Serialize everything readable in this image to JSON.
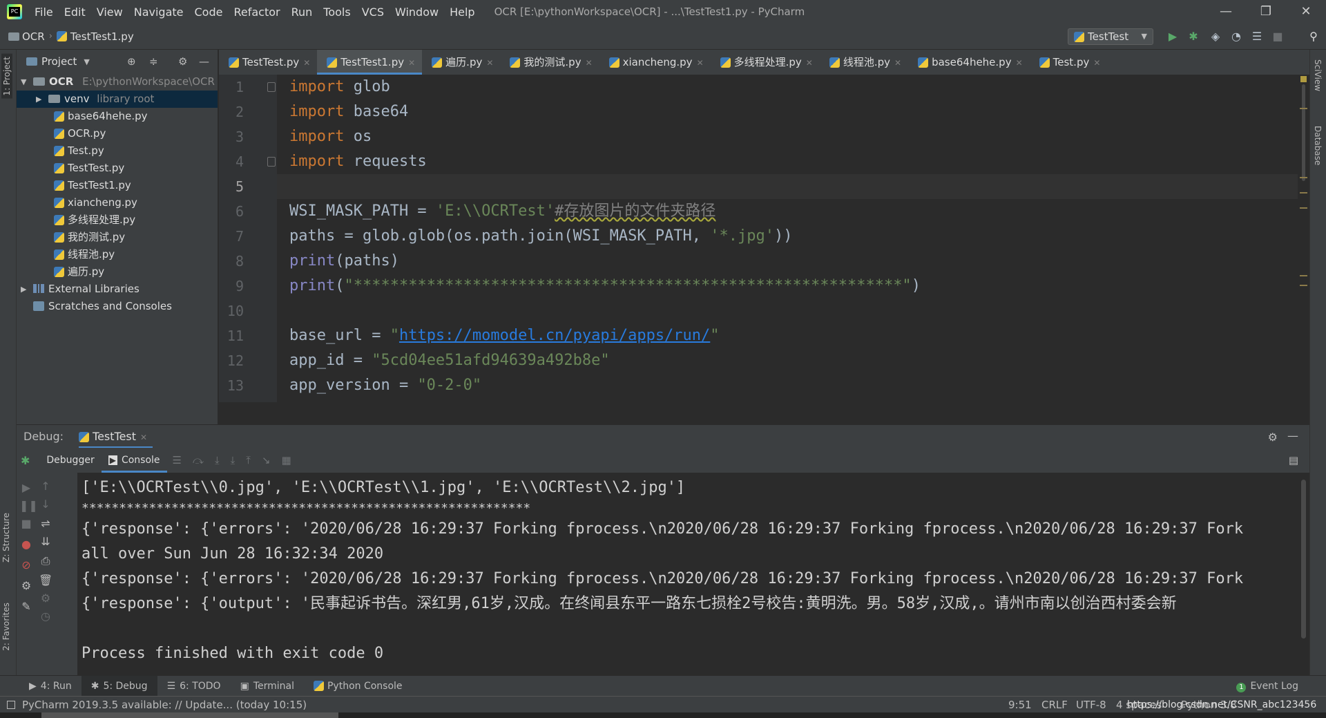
{
  "menu": {
    "items": [
      "File",
      "Edit",
      "View",
      "Navigate",
      "Code",
      "Refactor",
      "Run",
      "Tools",
      "VCS",
      "Window",
      "Help"
    ],
    "window_title": "OCR [E:\\pythonWorkspace\\OCR] - ...\\TestTest1.py - PyCharm"
  },
  "window_controls": {
    "minimize": "—",
    "restore": "❐",
    "close": "✕"
  },
  "navbar": {
    "project": "OCR",
    "file": "TestTest1.py",
    "run_config": "TestTest"
  },
  "left_strip": {
    "project": "1: Project",
    "structure": "Z: Structure",
    "favorites": "2: Favorites"
  },
  "right_strip": {
    "sciview": "SciView",
    "database": "Database"
  },
  "project_panel": {
    "title": "Project",
    "root": {
      "name": "OCR",
      "path": "E:\\pythonWorkspace\\OCR"
    },
    "venv": {
      "name": "venv",
      "suffix": "library root"
    },
    "files": [
      "base64hehe.py",
      "OCR.py",
      "Test.py",
      "TestTest.py",
      "TestTest1.py",
      "xiancheng.py",
      "多线程处理.py",
      "我的测试.py",
      "线程池.py",
      "遍历.py"
    ],
    "external": "External Libraries",
    "scratches": "Scratches and Consoles"
  },
  "editor": {
    "tabs": [
      "TestTest.py",
      "TestTest1.py",
      "遍历.py",
      "我的测试.py",
      "xiancheng.py",
      "多线程处理.py",
      "线程池.py",
      "base64hehe.py",
      "Test.py"
    ],
    "active_tab": 1,
    "line_numbers": [
      "1",
      "2",
      "3",
      "4",
      "5",
      "6",
      "7",
      "8",
      "9",
      "10",
      "11",
      "12",
      "13"
    ],
    "lines": {
      "l1_kw": "import",
      "l1_rest": " glob",
      "l2_kw": "import",
      "l2_rest": " base64",
      "l3_kw": "import",
      "l3_rest": " os",
      "l4_kw": "import",
      "l4_rest": " requests",
      "l6_a": "WSI_MASK_PATH = ",
      "l6_str": "'E:\\\\OCRTest'",
      "l6_cmt": "#存放图片的文件夹路径",
      "l7_a": "paths = glob.glob(os.path.join(WSI_MASK_PATH, ",
      "l7_str": "'*.jpg'",
      "l7_b": "))",
      "l8_fn": "print",
      "l8_b": "(paths)",
      "l9_fn": "print",
      "l9_a": "(",
      "l9_str": "\"************************************************************\"",
      "l9_b": ")",
      "l11_a": "base_url = ",
      "l11_q1": "\"",
      "l11_url": "https://momodel.cn/pyapi/apps/run/",
      "l11_q2": "\"",
      "l12_a": "app_id = ",
      "l12_str": "\"5cd04ee51afd94639a492b8e\"",
      "l13_a": "app_version = ",
      "l13_str": "\"0-2-0\""
    }
  },
  "debug": {
    "label": "Debug:",
    "session": "TestTest",
    "subtabs": {
      "debugger": "Debugger",
      "console": "Console"
    },
    "output": [
      "['E:\\\\OCRTest\\\\0.jpg', 'E:\\\\OCRTest\\\\1.jpg', 'E:\\\\OCRTest\\\\2.jpg']",
      "************************************************************",
      "{'response': {'errors': '2020/06/28 16:29:37 Forking fprocess.\\n2020/06/28 16:29:37 Forking fprocess.\\n2020/06/28 16:29:37 Fork",
      "all over Sun Jun 28 16:32:34 2020",
      "{'response': {'errors': '2020/06/28 16:29:37 Forking fprocess.\\n2020/06/28 16:29:37 Forking fprocess.\\n2020/06/28 16:29:37 Fork",
      "{'response': {'output': '民事起诉书告。深红男,61岁,汉成。在终闻县东平一路东七损栓2号校告:黄明洗。男。58岁,汉成,。请州市南以创治西村委会新",
      "",
      "Process finished with exit code 0"
    ]
  },
  "bottom_tabs": [
    "4: Run",
    "5: Debug",
    "6: TODO",
    "Terminal",
    "Python Console"
  ],
  "event_log": "Event Log",
  "event_count": "1",
  "status": {
    "message": "PyCharm 2019.3.5 available: // Update... (today 10:15)",
    "position": "9:51",
    "line_sep": "CRLF",
    "encoding": "UTF-8",
    "indent": "4 spaces",
    "interpreter": "Python 3.8",
    "watermark": "https://blog.csdn.net/CSNR_abc123456"
  }
}
